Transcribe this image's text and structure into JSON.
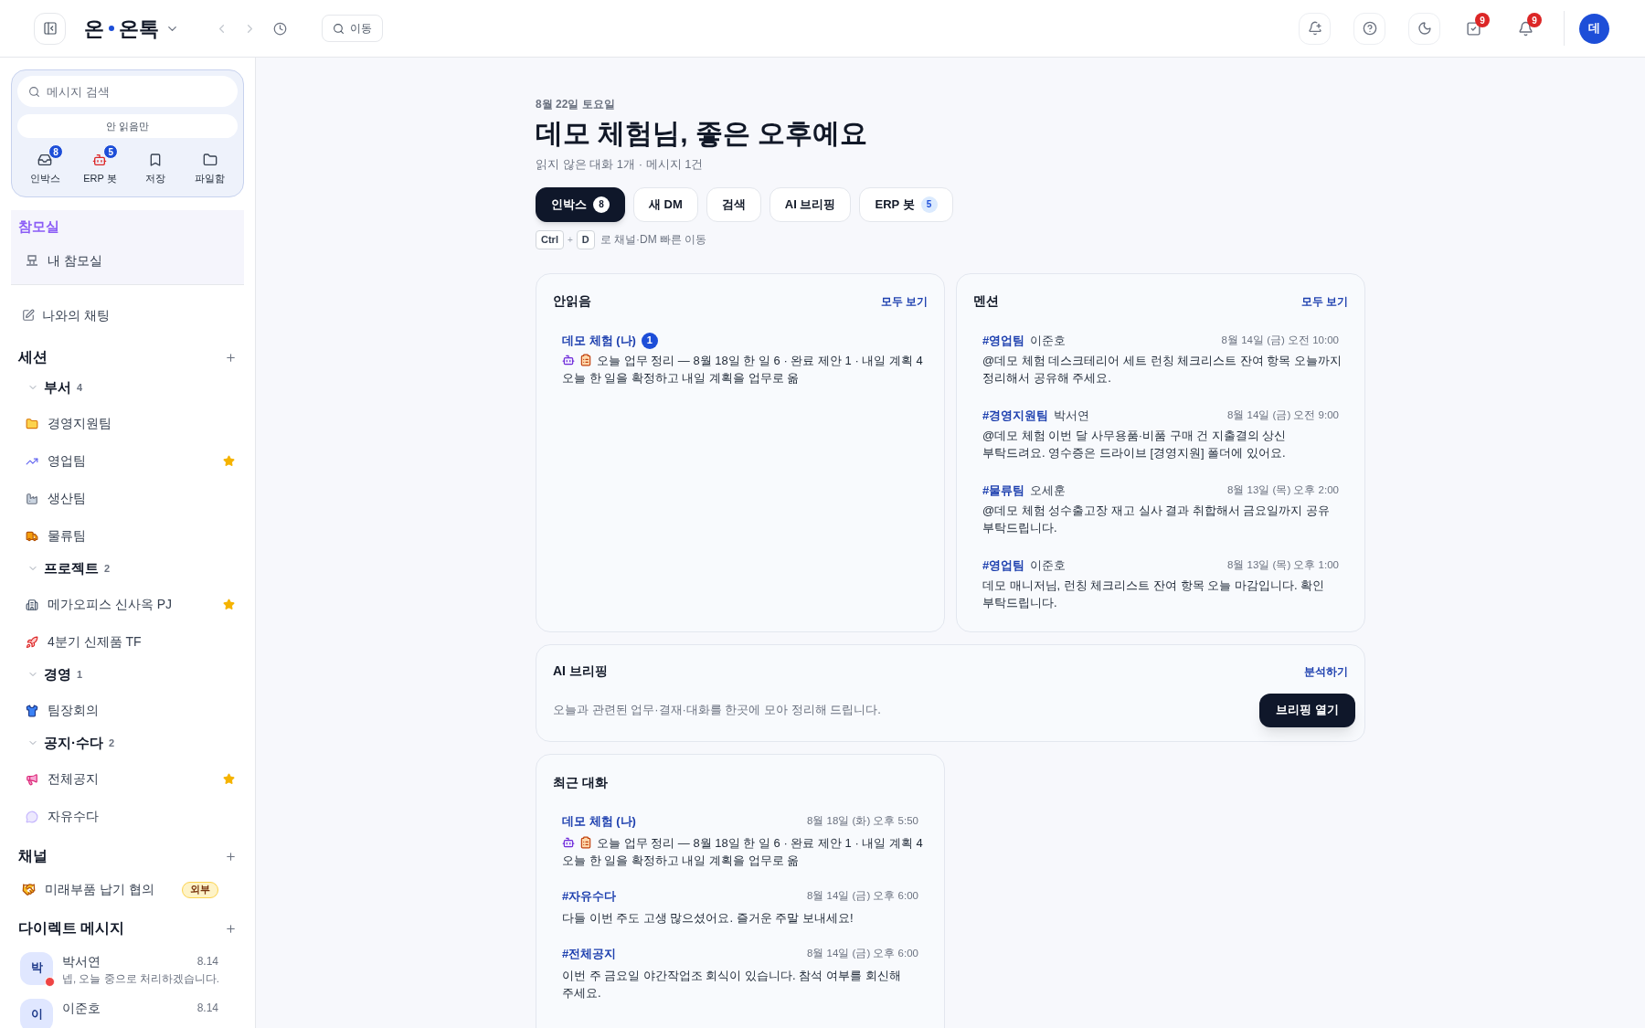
{
  "header": {
    "workspace": "온",
    "app": "온톡",
    "search_label": "이동",
    "tasks_badge": "9",
    "alerts_badge": "9",
    "avatar": "데"
  },
  "sidebar": {
    "search": {
      "placeholder": "메시지 검색"
    },
    "filter": {
      "label": "안 읽음만",
      "selected": false
    },
    "shortcuts": [
      {
        "label": "인박스",
        "badge": "8"
      },
      {
        "label": "ERP 봇",
        "badge": "5"
      },
      {
        "label": "저장"
      },
      {
        "label": "파일함"
      }
    ],
    "advisor": {
      "title": "참모실",
      "items": [
        {
          "label": "내 참모실"
        }
      ]
    },
    "self_chat": {
      "label": "나와의 채팅"
    },
    "sessions": {
      "title": "세션",
      "groups": [
        {
          "label": "부서",
          "count": "4",
          "expanded": true,
          "children": [
            {
              "label": "경영지원팀",
              "starred": false
            },
            {
              "label": "영업팀",
              "starred": true
            },
            {
              "label": "생산팀",
              "starred": false
            },
            {
              "label": "물류팀",
              "starred": false
            }
          ]
        },
        {
          "label": "프로젝트",
          "count": "2",
          "expanded": true,
          "children": [
            {
              "label": "메가오피스 신사옥 PJ",
              "starred": true
            },
            {
              "label": "4분기 신제품 TF",
              "starred": false
            }
          ]
        },
        {
          "label": "경영",
          "count": "1",
          "expanded": true,
          "children": [
            {
              "label": "팀장회의",
              "starred": false
            }
          ]
        },
        {
          "label": "공지·수다",
          "count": "2",
          "expanded": true,
          "children": [
            {
              "label": "전체공지",
              "starred": true
            },
            {
              "label": "자유수다",
              "starred": false
            }
          ]
        }
      ]
    },
    "channels": {
      "title": "채널",
      "items": [
        {
          "label": "미래부품 납기 협의",
          "tag": "외부"
        }
      ]
    },
    "direct_messages": {
      "title": "다이렉트 메시지",
      "items": [
        {
          "avatar": "박",
          "name": "박서연",
          "date": "8.14",
          "preview": "넵, 오늘 중으로 처리하겠습니다.",
          "unread": true
        },
        {
          "avatar": "이",
          "name": "이준호",
          "date": "8.14"
        }
      ]
    }
  },
  "main": {
    "greeting": {
      "date": "8월 22일 토요일",
      "title": "데모 체험님, 좋은 오후예요",
      "summary": "읽지 않은 대화 1개 · 메시지 1건"
    },
    "tabs": [
      {
        "label": "인박스",
        "badge": "8",
        "selected": true
      },
      {
        "label": "새 DM",
        "selected": false
      },
      {
        "label": "검색",
        "selected": false
      },
      {
        "label": "AI 브리핑",
        "selected": false
      },
      {
        "label": "ERP 봇",
        "badge": "5",
        "selected": false
      }
    ],
    "shortcut_hint": {
      "keys": [
        "Ctrl",
        "D"
      ],
      "joiner": "+",
      "text": "로 채널·DM 빠른 이동"
    },
    "unread": {
      "title": "안읽음",
      "link": "모두 보기",
      "items": [
        {
          "kind": "bot",
          "name": "데모 체험 (나)",
          "badge": "1",
          "lines": [
            "오늘 업무 정리 — 8월 18일 한 일 6 · 완료 제안 1 · 내일 계획 4",
            "오늘 한 일을 확정하고 내일 계획을 업무로 옮"
          ]
        }
      ]
    },
    "mentions": {
      "title": "멘션",
      "link": "모두 보기",
      "items": [
        {
          "channel": "#영업팀",
          "author": "이준호",
          "time": "8월 14일 (금) 오전 10:00",
          "lines": [
            "@데모 체험 데스크테리어 세트 런칭 체크리스트 잔여 항목 오늘까지",
            "정리해서 공유해 주세요."
          ]
        },
        {
          "channel": "#경영지원팀",
          "author": "박서연",
          "time": "8월 14일 (금) 오전 9:00",
          "lines": [
            "@데모 체험 이번 달 사무용품·비품 구매 건 지출결의 상신",
            "부탁드려요. 영수증은 드라이브 [경영지원] 폴더에 있어요."
          ]
        },
        {
          "channel": "#물류팀",
          "author": "오세훈",
          "time": "8월 13일 (목) 오후 2:00",
          "lines": [
            "@데모 체험 성수출고장 재고 실사 결과 취합해서 금요일까지 공유",
            "부탁드립니다."
          ]
        },
        {
          "channel": "#영업팀",
          "author": "이준호",
          "time": "8월 13일 (목) 오후 1:00",
          "lines": [
            "데모 매니저님, 런칭 체크리스트 잔여 항목 오늘 마감입니다. 확인",
            "부탁드립니다."
          ]
        }
      ]
    },
    "briefing": {
      "title": "AI 브리핑",
      "link": "분석하기",
      "description": "오늘과 관련된 업무·결재·대화를 한곳에 모아 정리해 드립니다.",
      "button": "브리핑 열기"
    },
    "recent": {
      "title": "최근 대화",
      "items": [
        {
          "kind": "bot",
          "name": "데모 체험 (나)",
          "time": "8월 18일 (화) 오후 5:50",
          "lines": [
            "오늘 업무 정리 — 8월 18일 한 일 6 · 완료 제안 1 · 내일 계획 4",
            "오늘 한 일을 확정하고 내일 계획을 업무로 옮"
          ]
        },
        {
          "kind": "channel",
          "name": "#자유수다",
          "time": "8월 14일 (금) 오후 6:00",
          "lines": [
            "다들 이번 주도 고생 많으셨어요. 즐거운 주말 보내세요!"
          ]
        },
        {
          "kind": "channel",
          "name": "#전체공지",
          "time": "8월 14일 (금) 오후 6:00",
          "lines": [
            "이번 주 금요일 야간작업조 회식이 있습니다. 참석 여부를 회신해",
            "주세요."
          ]
        }
      ]
    }
  }
}
